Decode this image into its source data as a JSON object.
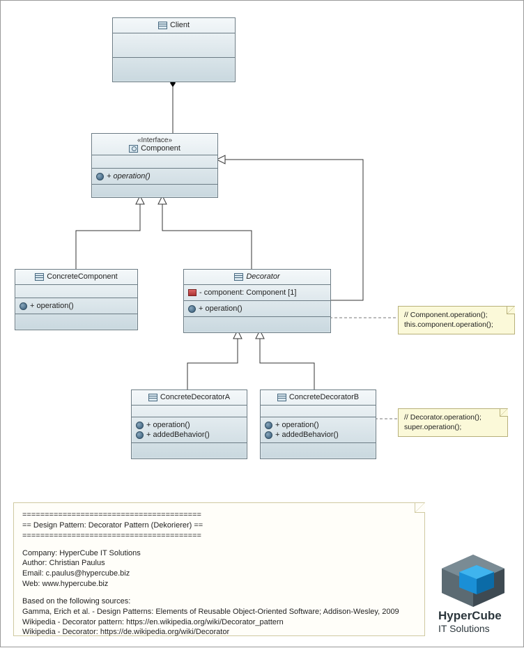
{
  "classes": {
    "client": {
      "name": "Client"
    },
    "component": {
      "stereotype": "«Interface»",
      "name": "Component",
      "ops": [
        "+ operation()"
      ]
    },
    "concreteComponent": {
      "name": "ConcreteComponent",
      "ops": [
        "+ operation()"
      ]
    },
    "decorator": {
      "name": "Decorator",
      "attrs": [
        "- component: Component [1]"
      ],
      "ops": [
        "+ operation()"
      ]
    },
    "concreteDecoratorA": {
      "name": "ConcreteDecoratorA",
      "ops": [
        "+ operation()",
        "+ addedBehavior()"
      ]
    },
    "concreteDecoratorB": {
      "name": "ConcreteDecoratorB",
      "ops": [
        "+ operation()",
        "+ addedBehavior()"
      ]
    }
  },
  "notes": {
    "decoratorOp": {
      "line1": "// Component.operation();",
      "line2": "this.component.operation();"
    },
    "concreteBOp": {
      "line1": "// Decorator.operation();",
      "line2": "super.operation();"
    }
  },
  "info": {
    "bar": "========================================",
    "title": "== Design Pattern: Decorator Pattern (Dekorierer) ==",
    "company": "Company: HyperCube IT Solutions",
    "author": "Author: Christian Paulus",
    "email": "Email: c.paulus@hypercube.biz",
    "web": "Web: www.hypercube.biz",
    "sourcesHdr": "Based on the following sources:",
    "src1": "Gamma, Erich et al. - Design Patterns: Elements of Reusable Object-Oriented Software; Addison-Wesley, 2009",
    "src2": "Wikipedia - Decorator pattern: https://en.wikipedia.org/wiki/Decorator_pattern",
    "src3": "Wikipedia - Decorator: https://de.wikipedia.org/wiki/Decorator"
  },
  "logo": {
    "line1": "HyperCube",
    "line2": "IT Solutions"
  }
}
